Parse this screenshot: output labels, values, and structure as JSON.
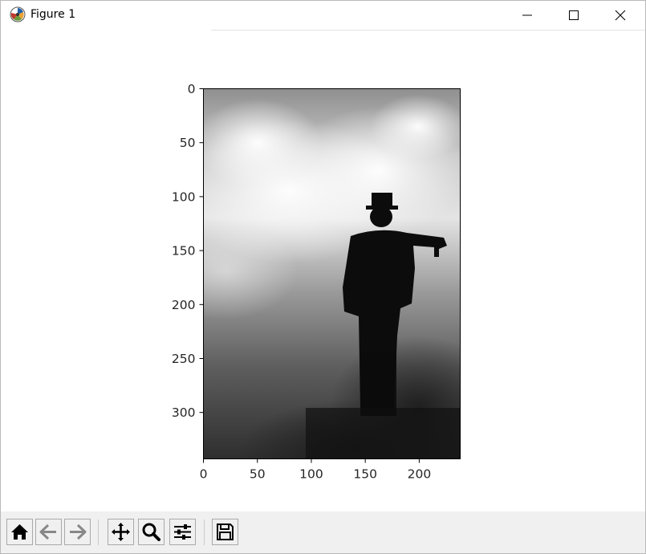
{
  "window": {
    "title": "Figure 1",
    "icons": {
      "app": "matplotlib-icon",
      "minimize": "minimize-icon",
      "maximize": "maximize-icon",
      "close": "close-icon"
    }
  },
  "chart_data": {
    "type": "image",
    "description_of_axes": "imshow grayscale image",
    "image_size": {
      "width": 238,
      "height": 343
    },
    "xlim": [
      0,
      238
    ],
    "ylim": [
      343,
      0
    ],
    "x_ticks": [
      0,
      50,
      100,
      150,
      200
    ],
    "y_ticks": [
      0,
      50,
      100,
      150,
      200,
      250,
      300
    ],
    "x_tick_labels": [
      "0",
      "50",
      "100",
      "150",
      "200"
    ],
    "y_tick_labels": [
      "0",
      "50",
      "100",
      "150",
      "200",
      "250",
      "300"
    ],
    "colormap": "gray"
  },
  "toolbar": {
    "buttons": [
      {
        "name": "home",
        "icon": "home-icon"
      },
      {
        "name": "back",
        "icon": "back-arrow-icon"
      },
      {
        "name": "forward",
        "icon": "forward-arrow-icon"
      },
      {
        "name": "pan",
        "icon": "move-icon"
      },
      {
        "name": "zoom",
        "icon": "zoom-icon"
      },
      {
        "name": "configure-subplots",
        "icon": "sliders-icon"
      },
      {
        "name": "save",
        "icon": "save-icon"
      }
    ]
  }
}
